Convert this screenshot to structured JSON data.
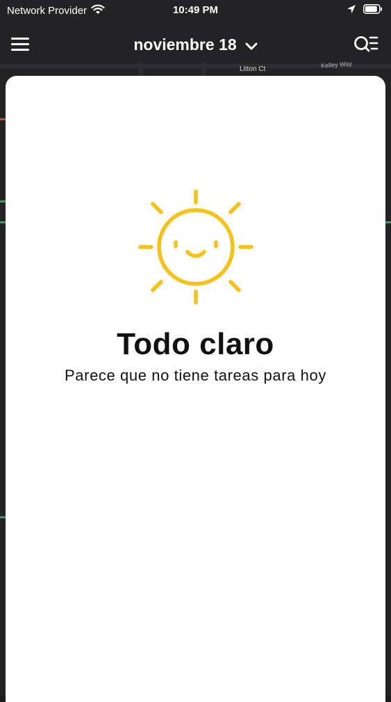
{
  "status_bar": {
    "carrier": "Network Provider",
    "time": "10:49 PM",
    "icons": [
      "wifi-icon",
      "location-arrow-icon",
      "battery-icon"
    ]
  },
  "nav": {
    "menu_icon": "hamburger-menu-icon",
    "date_label": "noviembre 18",
    "dropdown_icon": "chevron-down-icon",
    "search_icon": "search-list-icon"
  },
  "map": {
    "labels": [
      "Litton Ct",
      "Kelley Way"
    ]
  },
  "empty_state": {
    "icon": "smiling-sun-icon",
    "title": "Todo claro",
    "subtitle": "Parece que no tiene tareas para hoy"
  },
  "colors": {
    "sun": "#f7c214",
    "background": "#1c1c1e",
    "sheet": "#ffffff"
  }
}
